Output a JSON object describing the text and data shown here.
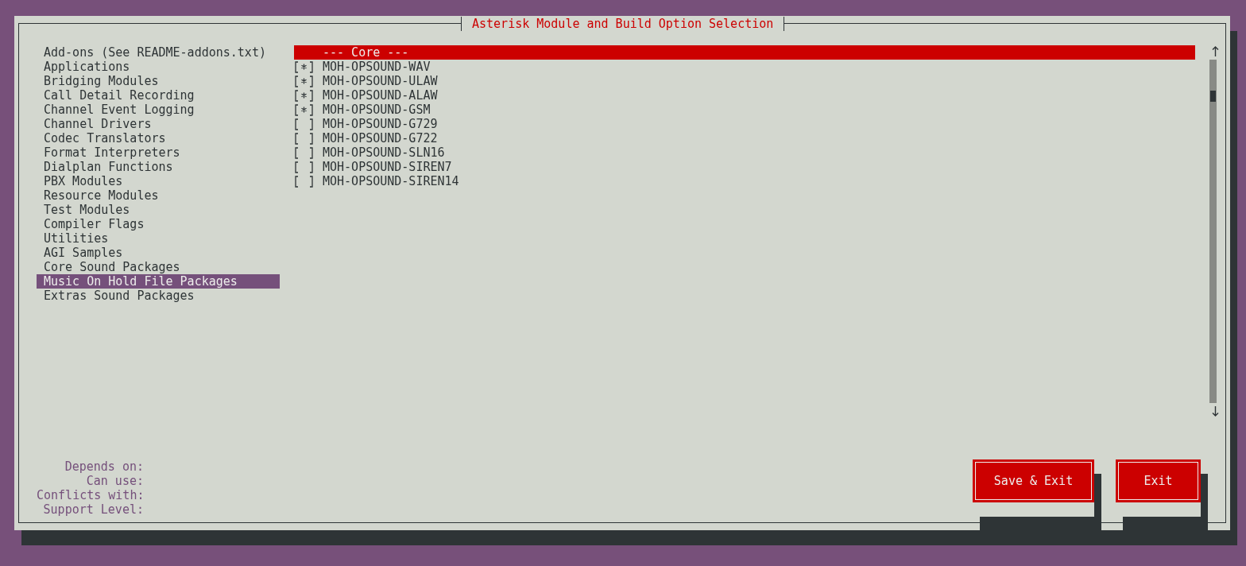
{
  "window": {
    "title": "Asterisk Module and Build Option Selection"
  },
  "categories": [
    {
      "label": "Add-ons (See README-addons.txt)",
      "selected": false
    },
    {
      "label": "Applications",
      "selected": false
    },
    {
      "label": "Bridging Modules",
      "selected": false
    },
    {
      "label": "Call Detail Recording",
      "selected": false
    },
    {
      "label": "Channel Event Logging",
      "selected": false
    },
    {
      "label": "Channel Drivers",
      "selected": false
    },
    {
      "label": "Codec Translators",
      "selected": false
    },
    {
      "label": "Format Interpreters",
      "selected": false
    },
    {
      "label": "Dialplan Functions",
      "selected": false
    },
    {
      "label": "PBX Modules",
      "selected": false
    },
    {
      "label": "Resource Modules",
      "selected": false
    },
    {
      "label": "Test Modules",
      "selected": false
    },
    {
      "label": "Compiler Flags",
      "selected": false
    },
    {
      "label": "Utilities",
      "selected": false
    },
    {
      "label": "AGI Samples",
      "selected": false
    },
    {
      "label": "Core Sound Packages",
      "selected": false
    },
    {
      "label": "Music On Hold File Packages",
      "selected": true
    },
    {
      "label": "Extras Sound Packages",
      "selected": false
    }
  ],
  "options_header": "--- Core ---",
  "options": [
    {
      "checked": true,
      "label": "MOH-OPSOUND-WAV"
    },
    {
      "checked": true,
      "label": "MOH-OPSOUND-ULAW"
    },
    {
      "checked": true,
      "label": "MOH-OPSOUND-ALAW"
    },
    {
      "checked": true,
      "label": "MOH-OPSOUND-GSM"
    },
    {
      "checked": false,
      "label": "MOH-OPSOUND-G729"
    },
    {
      "checked": false,
      "label": "MOH-OPSOUND-G722"
    },
    {
      "checked": false,
      "label": "MOH-OPSOUND-SLN16"
    },
    {
      "checked": false,
      "label": "MOH-OPSOUND-SIREN7"
    },
    {
      "checked": false,
      "label": "MOH-OPSOUND-SIREN14"
    }
  ],
  "info": [
    "Depends on:",
    "Can use:",
    "Conflicts with:",
    "Support Level:"
  ],
  "buttons": [
    "Save & Exit",
    "Exit"
  ]
}
